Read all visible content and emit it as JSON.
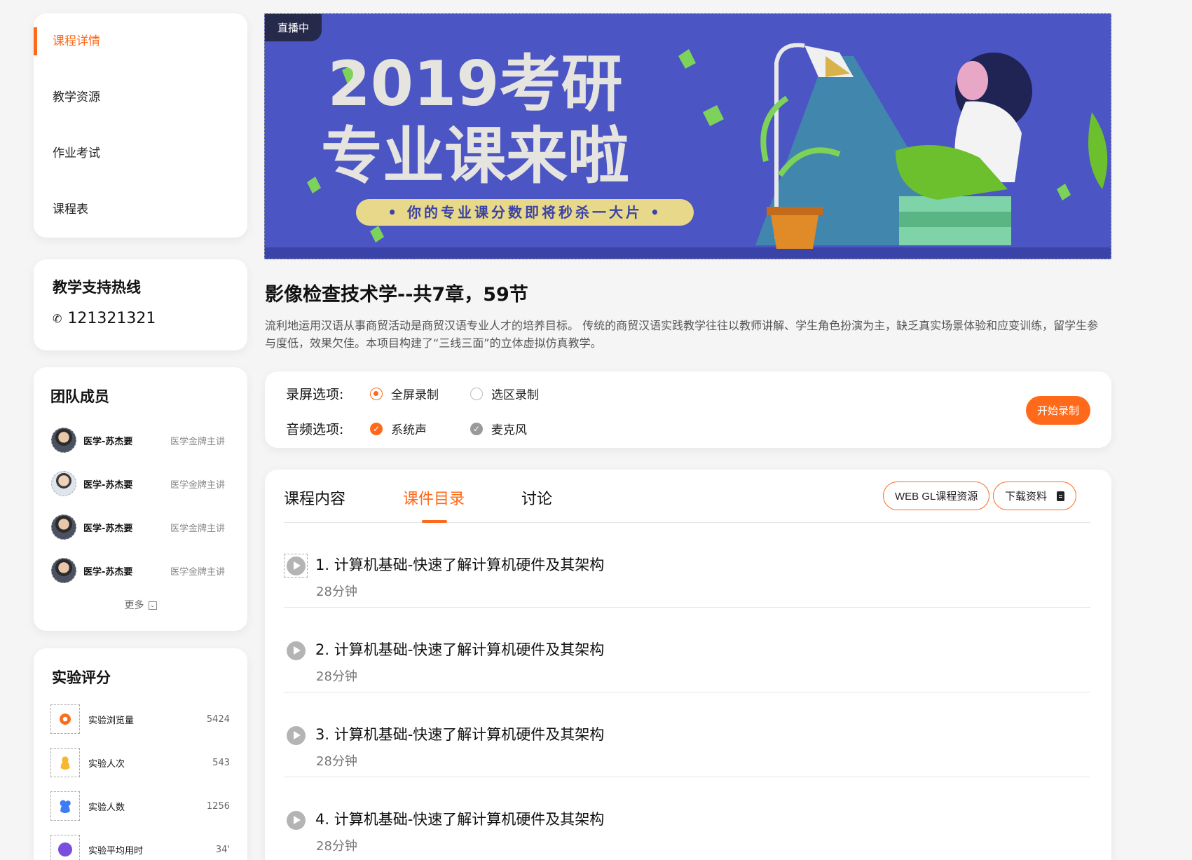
{
  "sidebar": {
    "nav": [
      {
        "label": "课程详情",
        "active": true
      },
      {
        "label": "教学资源",
        "active": false
      },
      {
        "label": "作业考试",
        "active": false
      },
      {
        "label": "课程表",
        "active": false
      }
    ],
    "hotline": {
      "title": "教学支持热线",
      "phone": "121321321",
      "icon": "phone-icon"
    },
    "team": {
      "title": "团队成员",
      "members": [
        {
          "name": "医学-苏杰要",
          "role": "医学金牌主讲"
        },
        {
          "name": "医学-苏杰要",
          "role": "医学金牌主讲"
        },
        {
          "name": "医学-苏杰要",
          "role": "医学金牌主讲"
        },
        {
          "name": "医学-苏杰要",
          "role": "医学金牌主讲"
        }
      ],
      "more_label": "更多"
    },
    "stats": {
      "title": "实验评分",
      "items": [
        {
          "label": "实验浏览量",
          "value": "5424",
          "icon": "eye-icon",
          "color": "#ff6a1a"
        },
        {
          "label": "实验人次",
          "value": "543",
          "icon": "person-icon",
          "color": "#f7b731"
        },
        {
          "label": "实验人数",
          "value": "1256",
          "icon": "people-icon",
          "color": "#3d7bf7"
        },
        {
          "label": "实验平均用时",
          "value": "34'",
          "icon": "clock-icon",
          "color": "#7a4fe0"
        }
      ]
    }
  },
  "banner": {
    "badge": "直播中",
    "headline_1": "2019考研",
    "headline_2": "专业课来啦",
    "tagline": "• 你的专业课分数即将秒杀一大片 •"
  },
  "course": {
    "title": "影像检查技术学--共7章，59节",
    "description": "流利地运用汉语从事商贸活动是商贸汉语专业人才的培养目标。 传统的商贸汉语实践教学往往以教师讲解、学生角色扮演为主，缺乏真实场景体验和应变训练，留学生参与度低，效果欠佳。本项目构建了“三线三面”的立体虚拟仿真教学。"
  },
  "record": {
    "screen_label": "录屏选项:",
    "screen_options": [
      "全屏录制",
      "选区录制"
    ],
    "audio_label": "音频选项:",
    "audio_options": [
      "系统声",
      "麦克风"
    ],
    "start_label": "开始录制"
  },
  "content": {
    "tabs": [
      "课程内容",
      "课件目录",
      "讨论"
    ],
    "active_tab": "课件目录",
    "webgl_label": "WEB GL课程资源",
    "download_label": "下载资料",
    "lessons": [
      {
        "title": "1.  计算机基础-快速了解计算机硬件及其架构",
        "duration": "28分钟"
      },
      {
        "title": "2.  计算机基础-快速了解计算机硬件及其架构",
        "duration": "28分钟"
      },
      {
        "title": "3.  计算机基础-快速了解计算机硬件及其架构",
        "duration": "28分钟"
      },
      {
        "title": "4.  计算机基础-快速了解计算机硬件及其架构",
        "duration": "28分钟"
      }
    ]
  },
  "colors": {
    "accent": "#ff6a1a",
    "banner_bg": "#4b55c4"
  }
}
